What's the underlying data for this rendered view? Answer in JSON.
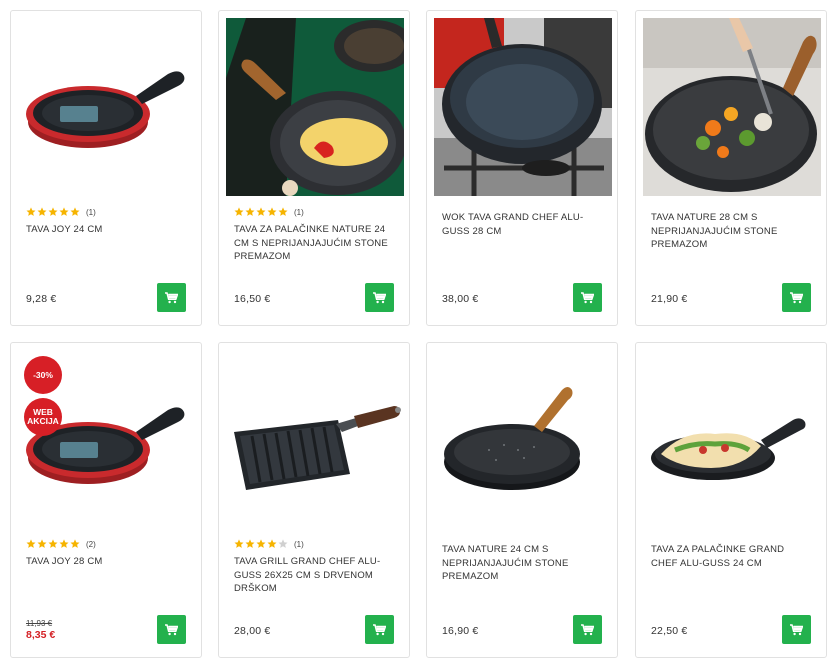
{
  "products": [
    {
      "title": "TAVA JOY 24 CM",
      "rating": 5,
      "rating_count": "(1)",
      "price": "9,28 €"
    },
    {
      "title": "TAVA ZA PALAČINKE NATURE 24 CM S NEPRIJANJAJUĆIM STONE PREMAZOM",
      "rating": 5,
      "rating_count": "(1)",
      "price": "16,50 €"
    },
    {
      "title": "WOK TAVA GRAND CHEF ALU-GUSS 28 CM",
      "price": "38,00 €"
    },
    {
      "title": "TAVA NATURE 28 CM S NEPRIJANJAJUĆIM STONE PREMAZOM",
      "price": "21,90 €"
    },
    {
      "title": "TAVA JOY 28 CM",
      "rating": 5,
      "rating_count": "(2)",
      "old_price": "11,93 €",
      "price": "8,35 €",
      "badges": [
        "-30%",
        "WEB AKCIJA"
      ]
    },
    {
      "title": "TAVA GRILL GRAND CHEF ALU-GUSS 26x25 CM S DRVENOM DRŠKOM",
      "rating": 4,
      "rating_count": "(1)",
      "price": "28,00 €"
    },
    {
      "title": "TAVA NATURE 24 CM S NEPRIJANJAJUĆIM STONE PREMAZOM",
      "price": "16,90 €"
    },
    {
      "title": "TAVA ZA PALAČINKE GRAND CHEF ALU-GUSS 24 CM",
      "price": "22,50 €"
    }
  ],
  "icons": {
    "cart": "cart-icon",
    "star": "star-icon"
  },
  "colors": {
    "cart_button": "#23b14d",
    "star_filled": "#f6b400",
    "star_empty": "#d0d0d0",
    "sale_price": "#d42025",
    "badge": "#d71f26"
  }
}
